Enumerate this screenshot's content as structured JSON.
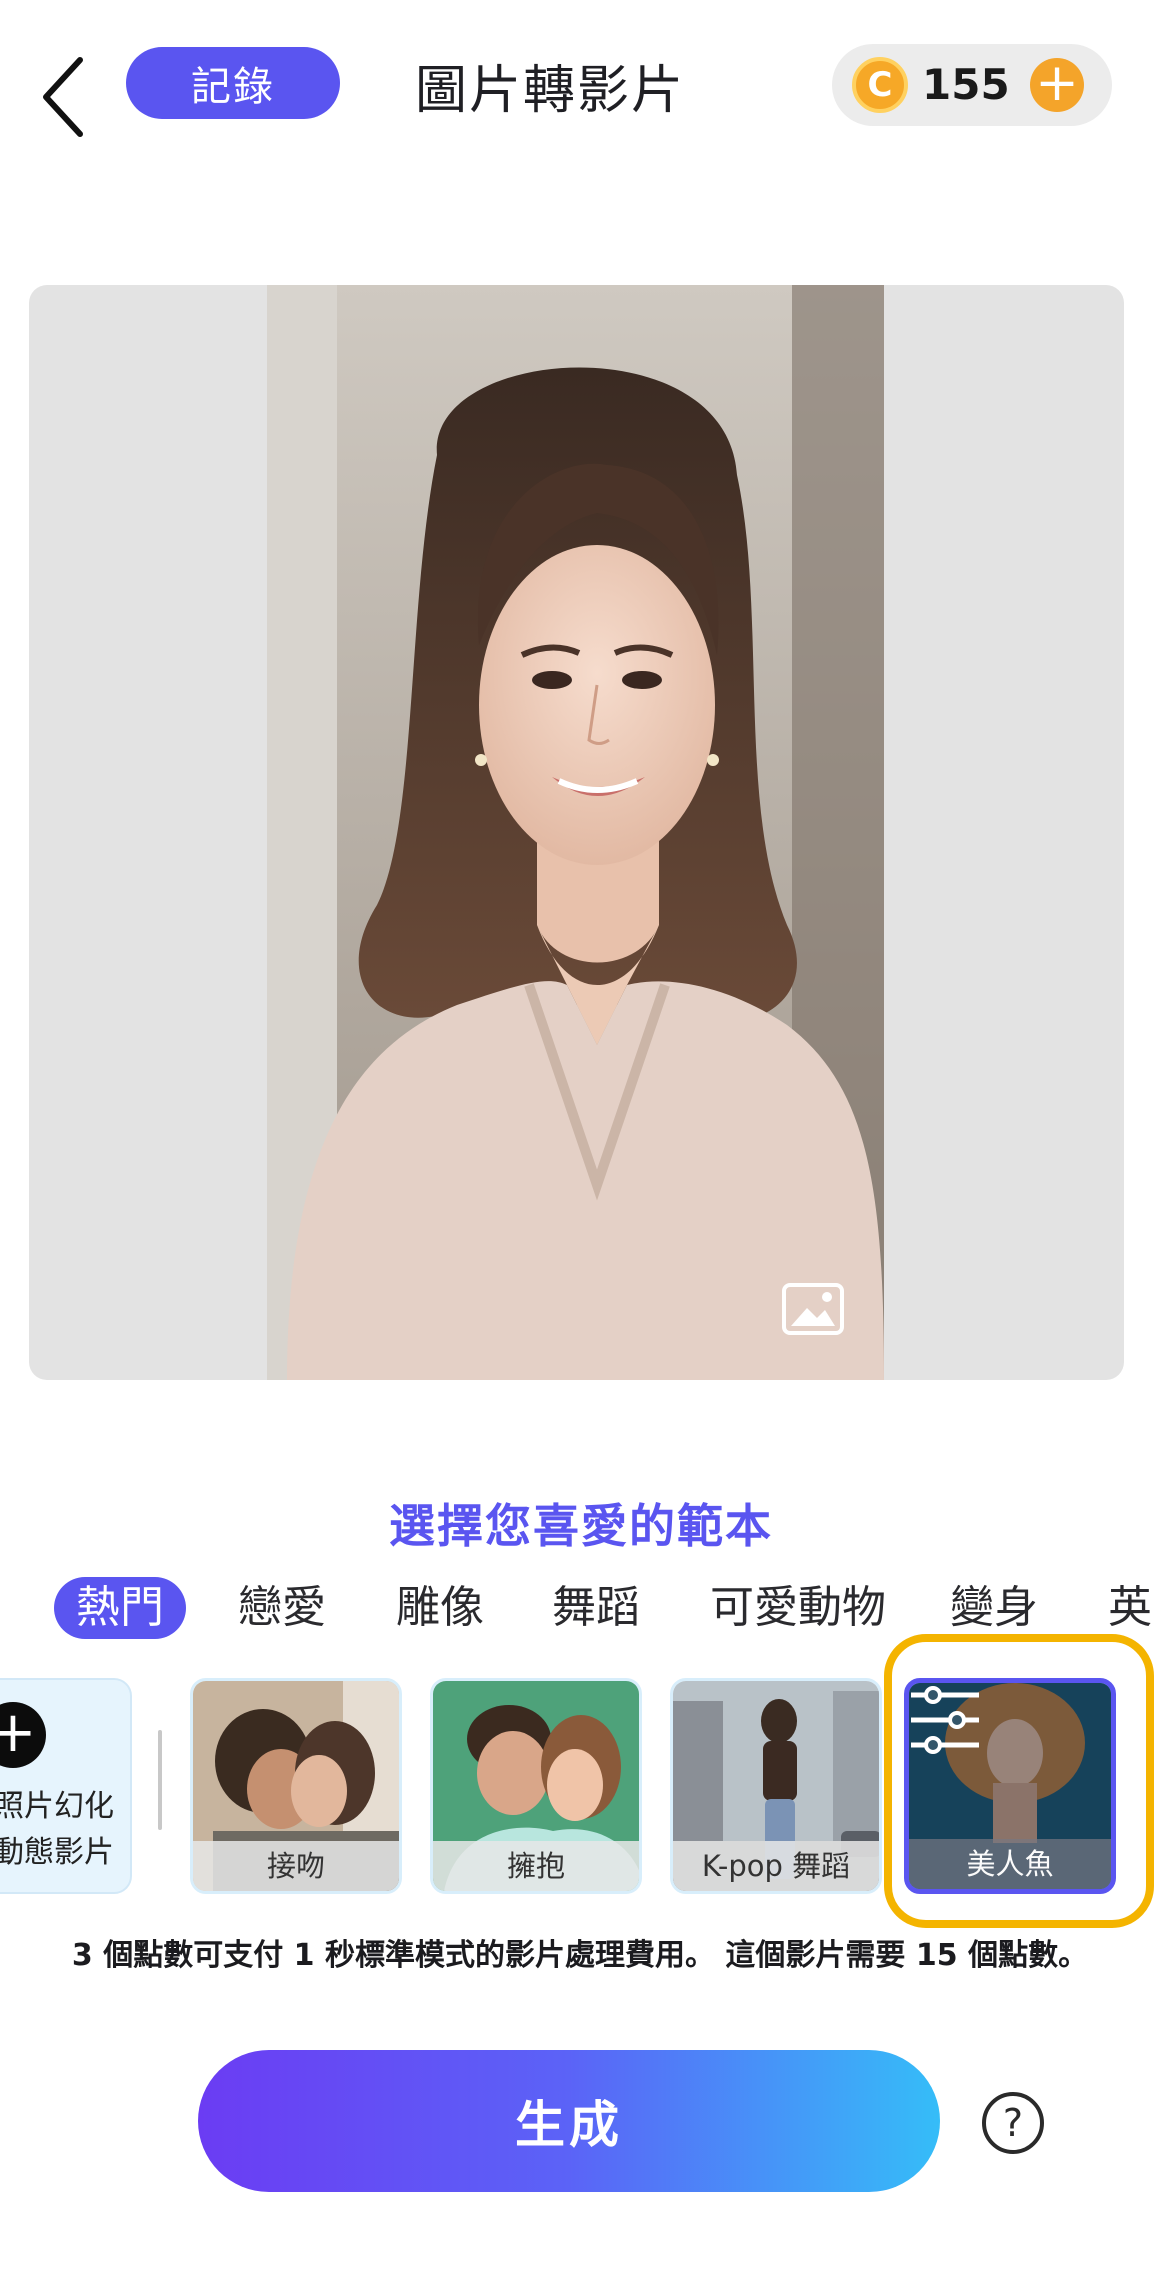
{
  "header": {
    "record_label": "記錄",
    "title": "圖片轉影片",
    "credits": "155",
    "coin_symbol": "C"
  },
  "templates": {
    "title": "選擇您喜愛的範本",
    "categories": [
      "熱門",
      "戀愛",
      "雕像",
      "舞蹈",
      "可愛動物",
      "變身",
      "英"
    ],
    "magic_card_text": "照片幻化\n動態影片",
    "items": [
      {
        "label": "接吻"
      },
      {
        "label": "擁抱"
      },
      {
        "label": "K-pop 舞蹈"
      },
      {
        "label": "美人魚",
        "selected": true
      }
    ]
  },
  "info_text": "3 個點數可支付 1 秒標準模式的影片處理費用。 這個影片需要 15 個點數。",
  "generate_label": "生成",
  "colors": {
    "accent": "#5a55f0",
    "highlight": "#f4b400",
    "coin": "#f6a827"
  }
}
